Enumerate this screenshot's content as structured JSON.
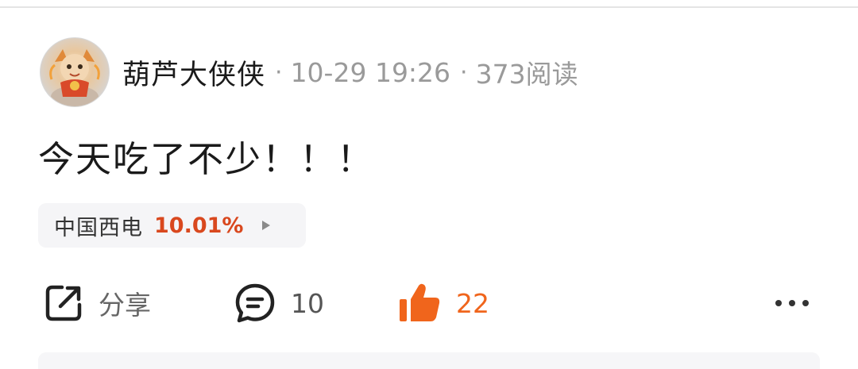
{
  "post": {
    "author": {
      "name": "葫芦大侠侠",
      "avatar_icon": "cartoon-character-avatar"
    },
    "separator": "·",
    "time": "10-29 19:26",
    "reads": "373阅读",
    "content": "今天吃了不少！！！"
  },
  "stock": {
    "name": "中国西电",
    "change": "10.01%",
    "change_color": "#d9481e",
    "arrow_icon": "play-arrow-icon"
  },
  "actions": {
    "share": {
      "label": "分享",
      "icon": "share-icon",
      "color": "#666666"
    },
    "comment": {
      "count": "10",
      "icon": "comment-icon",
      "color": "#555555"
    },
    "like": {
      "count": "22",
      "icon": "thumbs-up-icon",
      "color": "#f0651c"
    },
    "more": {
      "icon": "more-icon"
    }
  },
  "colors": {
    "text_primary": "#1a1a1a",
    "text_secondary": "#9a9a9a",
    "accent_like": "#f0651c",
    "chip_bg": "#f5f5f7"
  }
}
